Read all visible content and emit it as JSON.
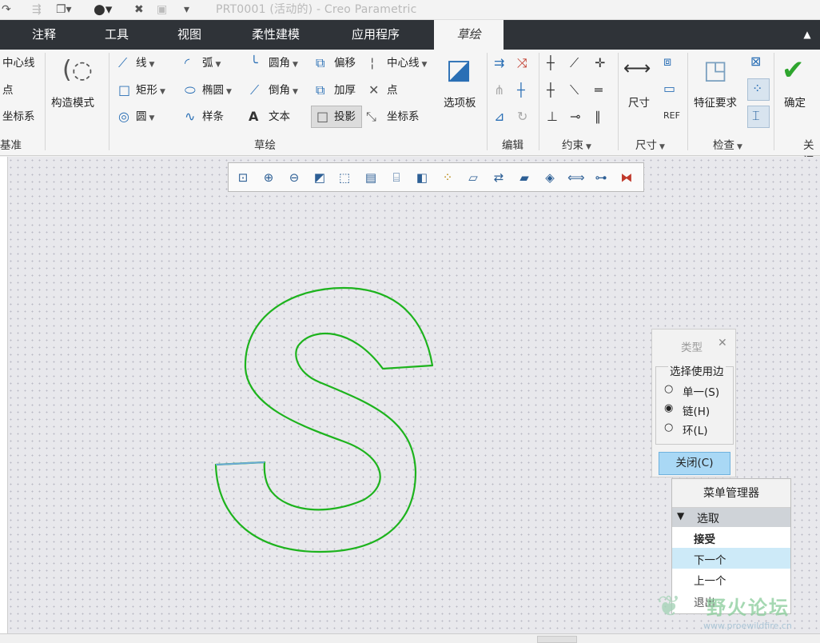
{
  "window": {
    "title": "PRT0001 (活动的) - Creo Parametric"
  },
  "quick_access": {
    "icons": [
      "redo-icon",
      "regenerate-icon",
      "windows-icon",
      "appearance-icon",
      "close-window-icon",
      "save-icon",
      "customize-icon"
    ]
  },
  "tabs": [
    "注释",
    "工具",
    "视图",
    "柔性建模",
    "应用程序",
    "草绘"
  ],
  "active_tab": "草绘",
  "ribbon": {
    "datum": {
      "items": [
        "中心线",
        "点",
        "坐标系"
      ],
      "group_label": "基准"
    },
    "construction_mode": "构造模式",
    "sketch": {
      "items": [
        "线",
        "弧",
        "圆角",
        "偏移",
        "中心线",
        "矩形",
        "椭圆",
        "倒角",
        "加厚",
        "点",
        "圆",
        "样条",
        "文本",
        "投影",
        "坐标系"
      ],
      "palette": "选项板",
      "group_label": "草绘"
    },
    "edit": {
      "group_label": "编辑"
    },
    "constrain": {
      "group_label": "约束"
    },
    "dimension": {
      "label": "尺寸",
      "group_label": "尺寸"
    },
    "inspect": {
      "feature_requirements": "特征要求",
      "group_label": "检查"
    },
    "ok": {
      "label": "确定",
      "group_label": "关闭"
    }
  },
  "type_dialog": {
    "title": "类型",
    "group_title": "选择使用边",
    "options": [
      "单一(S)",
      "链(H)",
      "环(L)"
    ],
    "selected": "链(H)",
    "close_button": "关闭(C)"
  },
  "menu_manager": {
    "title": "菜单管理器",
    "section": "选取",
    "items": [
      "接受",
      "下一个",
      "上一个",
      "退出"
    ],
    "highlighted": "下一个"
  },
  "watermark": {
    "text": "野火论坛",
    "url": "www.proewildfire.cn"
  },
  "colors": {
    "sketch_green": "#1db31d",
    "highlight_blue": "#6aa8d8",
    "tab_bar": "#2f3338"
  }
}
